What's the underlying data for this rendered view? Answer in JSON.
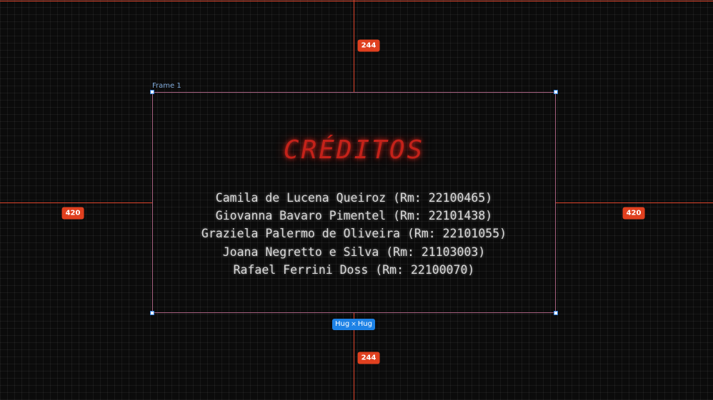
{
  "canvas": {
    "frame_label": "Frame 1",
    "measurements": {
      "top": "244",
      "bottom": "244",
      "left": "420",
      "right": "420"
    },
    "hug": {
      "width": "Hug",
      "separator": "×",
      "height": "Hug"
    }
  },
  "frame": {
    "title": "CRÉDITOS",
    "names": [
      "Camila de Lucena Queiroz (Rm: 22100465)",
      "Giovanna Bavaro Pimentel (Rm: 22101438)",
      "Graziela Palermo de Oliveira (Rm: 22101055)",
      "Joana Negretto e Silva (Rm: 21103003)",
      "Rafael Ferrini Doss (Rm: 22100070)"
    ]
  },
  "colors": {
    "background": "#0b0b0b",
    "guide": "#e0452c",
    "title_red": "#c4221a",
    "selection_blue": "#1d82e6",
    "frame_border": "#a45f7e"
  }
}
